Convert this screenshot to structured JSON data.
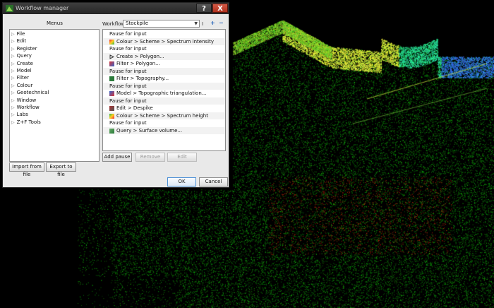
{
  "window": {
    "title": "Workflow manager",
    "help_glyph": "?",
    "close_glyph": "X"
  },
  "menus": {
    "header": "Menus",
    "items": [
      "File",
      "Edit",
      "Register",
      "Query",
      "Create",
      "Model",
      "Filter",
      "Colour",
      "Geotechnical",
      "Window",
      "Workflow",
      "Labs",
      "Z+F Tools"
    ]
  },
  "workflow": {
    "label": "Workflow",
    "selected": "Stockpile",
    "steps": [
      {
        "text": "Pause for input",
        "icon": ""
      },
      {
        "text": "Colour > Scheme > Spectrum intensity",
        "icon": "spectrum-icon"
      },
      {
        "text": "Pause for input",
        "icon": ""
      },
      {
        "text": "Create > Polygon...",
        "icon": "polygon-icon"
      },
      {
        "text": "Filter > Polygon...",
        "icon": "filter-polygon-icon"
      },
      {
        "text": "Pause for input",
        "icon": ""
      },
      {
        "text": "Filter > Topography...",
        "icon": "topography-icon"
      },
      {
        "text": "Pause for input",
        "icon": ""
      },
      {
        "text": "Model > Topographic triangulation...",
        "icon": "triangulation-icon"
      },
      {
        "text": "Pause for input",
        "icon": ""
      },
      {
        "text": "Edit > Despike",
        "icon": "despike-icon"
      },
      {
        "text": "Colour > Scheme > Spectrum height",
        "icon": "spectrum-height-icon"
      },
      {
        "text": "Pause for input",
        "icon": ""
      },
      {
        "text": "Query > Surface volume...",
        "icon": "surface-volume-icon"
      }
    ]
  },
  "buttons": {
    "import": "Import from file",
    "export": "Export to file",
    "add_pause": "Add pause",
    "remove": "Remove",
    "edit": "Edit",
    "ok": "OK",
    "cancel": "Cancel"
  },
  "toolbar": {
    "rename_glyph": "I",
    "add_glyph": "+",
    "remove_glyph": "−"
  },
  "colors": {
    "accent": "#4a8fd6",
    "titlebar": "#2e2e2e",
    "close": "#c0392b"
  }
}
